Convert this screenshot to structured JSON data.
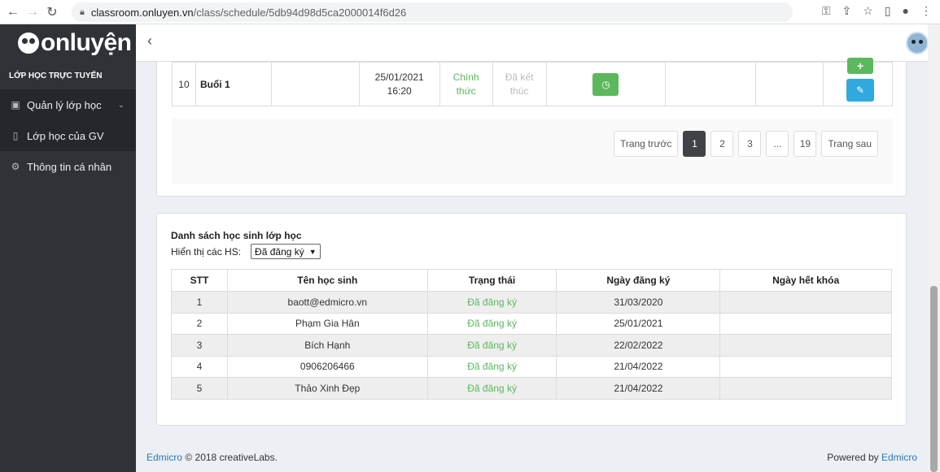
{
  "browser": {
    "url_host": "classroom.onluyen.vn",
    "url_path": "/class/schedule/5db94d98d5ca2000014f6d26"
  },
  "sidebar": {
    "logo": "onluyện",
    "section_title": "LỚP HỌC TRỰC TUYẾN",
    "items": [
      {
        "label": "Quản lý lớp học",
        "icon": "briefcase-icon"
      },
      {
        "label": "Lớp học của GV",
        "icon": "book-icon"
      },
      {
        "label": "Thông tin cá nhân",
        "icon": "gear-icon"
      }
    ]
  },
  "schedule_row": {
    "index": "10",
    "session": "Buổi 1",
    "datetime_date": "25/01/2021",
    "datetime_time": "16:20",
    "type_1": "Chính",
    "type_2": "thức",
    "status_1": "Đã kết",
    "status_2": "thúc",
    "colors": {
      "clock_btn": "#5cb85c",
      "add_btn": "#5cb85c",
      "edit_btn": "#31a9de"
    }
  },
  "pagination": {
    "prev": "Trang trước",
    "pages": [
      "1",
      "2",
      "3",
      "...",
      "19"
    ],
    "next": "Trang sau",
    "active": "1"
  },
  "students": {
    "title": "Danh sách học sinh lớp học",
    "filter_label": "Hiển thị các HS:",
    "filter_value": "Đã đăng ký",
    "columns": [
      "STT",
      "Tên học sinh",
      "Trạng thái",
      "Ngày đăng ký",
      "Ngày hết khóa"
    ],
    "rows": [
      {
        "stt": "1",
        "name": "baott@edmicro.vn",
        "status": "Đã đăng ký",
        "registered": "31/03/2020",
        "expires": ""
      },
      {
        "stt": "2",
        "name": "Phạm Gia Hân",
        "status": "Đã đăng ký",
        "registered": "25/01/2021",
        "expires": ""
      },
      {
        "stt": "3",
        "name": "Bích Hạnh",
        "status": "Đã đăng ký",
        "registered": "22/02/2022",
        "expires": ""
      },
      {
        "stt": "4",
        "name": "0906206466",
        "status": "Đã đăng ký",
        "registered": "21/04/2022",
        "expires": ""
      },
      {
        "stt": "5",
        "name": "Thảo Xinh Đẹp",
        "status": "Đã đăng ký",
        "registered": "21/04/2022",
        "expires": ""
      }
    ]
  },
  "footer": {
    "brand": "Edmicro",
    "copyright": "© 2018 creativeLabs.",
    "powered": "Powered by",
    "powered_brand": "Edmicro"
  }
}
